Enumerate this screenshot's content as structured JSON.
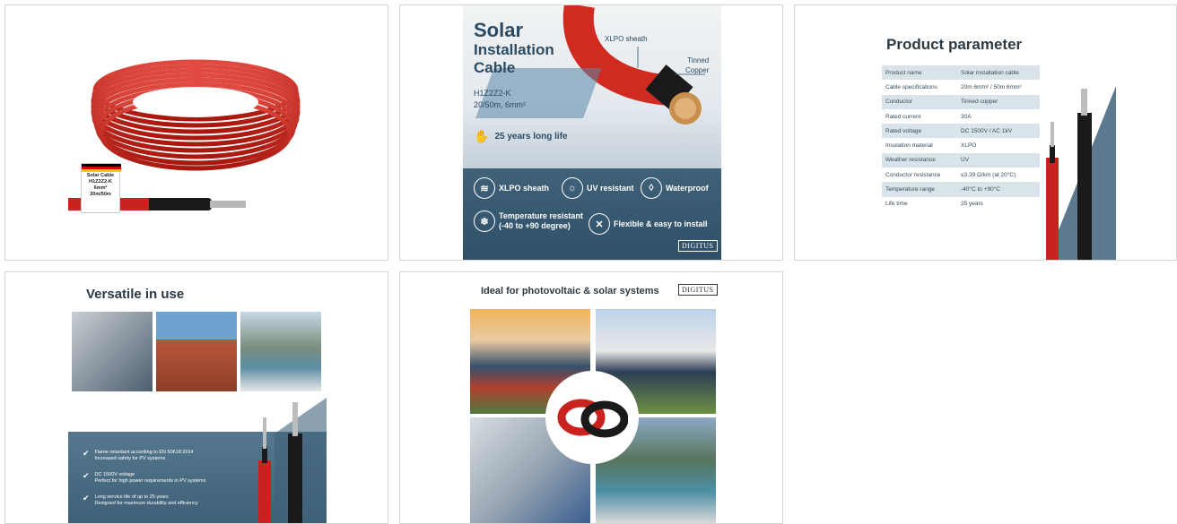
{
  "card1": {
    "label_line1": "Solar Cable",
    "label_line2": "H1Z2Z2-K",
    "label_line3": "6mm²",
    "label_line4": "20m/50m"
  },
  "card2": {
    "title_big": "Solar",
    "title_line2": "Installation",
    "title_line3": "Cable",
    "spec_line1": "H1Z2Z2-K",
    "spec_line2": "20/50m, 6mm²",
    "callout_sheath": "XLPO sheath",
    "callout_copper_1": "Tinned",
    "callout_copper_2": "Copper",
    "life": "25 years long life",
    "features": {
      "xlpo": "XLPO sheath",
      "uv": "UV resistant",
      "waterproof": "Waterproof",
      "temp_1": "Temperature resistant",
      "temp_2": "(-40 to +90 degree)",
      "flexible": "Flexible & easy to install"
    },
    "brand": "DIGITUS"
  },
  "card3": {
    "title": "Product parameter",
    "rows": [
      {
        "k": "Product name",
        "v": "Solar installation cable"
      },
      {
        "k": "Cable specifications",
        "v": "20m 6mm² / 50m 6mm²"
      },
      {
        "k": "Conductor",
        "v": "Tinned copper"
      },
      {
        "k": "Rated current",
        "v": "30A"
      },
      {
        "k": "Rated voltage",
        "v": "DC 1500V / AC 1kV"
      },
      {
        "k": "Insulation material",
        "v": "XLPO"
      },
      {
        "k": "Weather resistance",
        "v": "UV"
      },
      {
        "k": "Conductor resistance",
        "v": "≤3.39 Ω/km (at 20°C)"
      },
      {
        "k": "Temperature range",
        "v": "-40°C to +90°C"
      },
      {
        "k": "Life time",
        "v": "25 years"
      }
    ]
  },
  "card4": {
    "title": "Versatile in use",
    "bullets": [
      {
        "l1": "Flame retardant according to EN 50618:2014",
        "l2": "Increased safety for PV systems"
      },
      {
        "l1": "DC 1500V voltage",
        "l2": "Perfect for high power requirements in PV systems"
      },
      {
        "l1": "Long service life of up to 25 years",
        "l2": "Designed for maximum durability and efficiency"
      }
    ]
  },
  "card5": {
    "title": "Ideal for photovoltaic & solar systems",
    "brand": "DIGITUS"
  },
  "colors": {
    "cable_red": "#c8231e",
    "cable_black": "#1a1a1a",
    "panel_blue": "#3f6279",
    "table_row": "#d9e4ea"
  }
}
